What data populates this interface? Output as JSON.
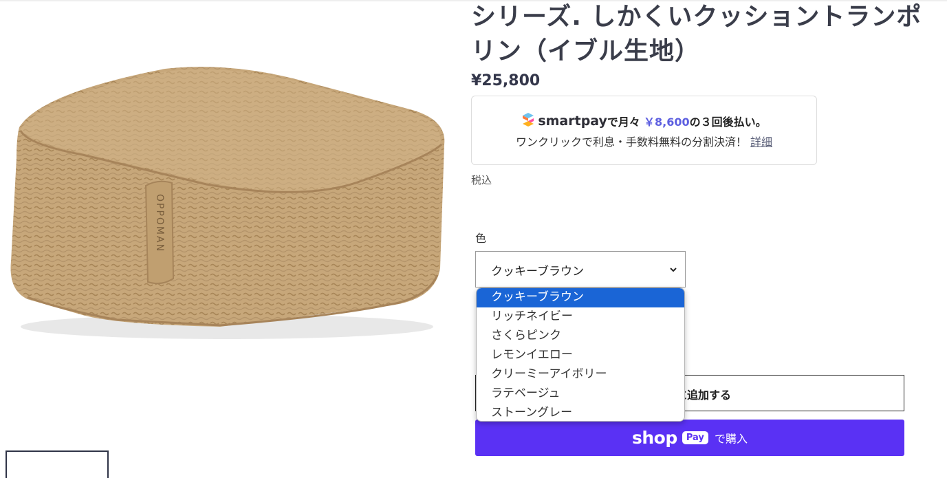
{
  "product": {
    "title": "シリーズ. しかくいクッショントランポリン（イブル生地）",
    "price": "¥25,800",
    "tax_note": "税込"
  },
  "smartpay": {
    "brand": "smartpay",
    "prefix": "で月々",
    "amount": "￥8,600",
    "suffix": "の３回後払い。",
    "line2": "ワンクリックで利息・手数料無料の分割決済！",
    "link_label": "詳細",
    "amount_color": "#5c5ee0"
  },
  "variant": {
    "label": "色",
    "selected": "クッキーブラウン",
    "options": [
      "クッキーブラウン",
      "リッチネイビー",
      "さくらピンク",
      "レモンイエロー",
      "クリーミーアイボリー",
      "ラテベージュ",
      "ストーングレー"
    ]
  },
  "buttons": {
    "add_to_cart_visible": "に追加する",
    "shop_word": "shop",
    "shop_badge": "Pay",
    "shop_suffix": "で購入",
    "shop_color": "#5a31f4"
  },
  "image": {
    "embroidered_text": "OPPOMAN"
  }
}
